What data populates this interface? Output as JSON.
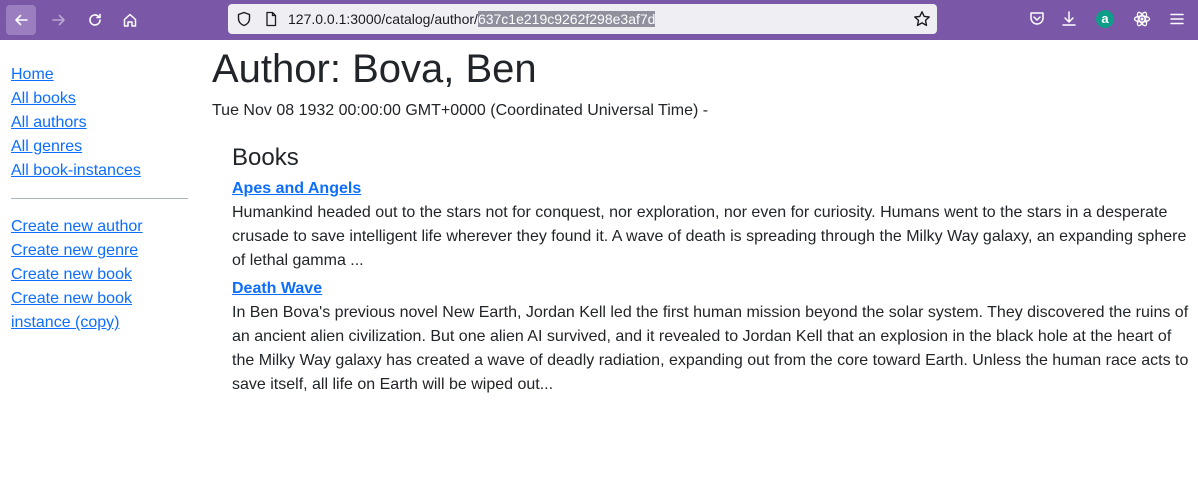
{
  "browser": {
    "url_prefix": "127.0.0.1:3000/catalog/author/",
    "url_selected": "637c1e219c9262f298e3af7d",
    "toolbar_color": "#7b57a8",
    "extension_a_label": "a"
  },
  "sidebar": {
    "nav": [
      {
        "label": "Home"
      },
      {
        "label": "All books"
      },
      {
        "label": "All authors"
      },
      {
        "label": "All genres"
      },
      {
        "label": "All book-instances"
      }
    ],
    "create": [
      {
        "label": "Create new author"
      },
      {
        "label": "Create new genre"
      },
      {
        "label": "Create new book"
      },
      {
        "label": "Create new book instance (copy)"
      }
    ]
  },
  "author": {
    "title": "Author: Bova, Ben",
    "dates": "Tue Nov 08 1932 00:00:00 GMT+0000 (Coordinated Universal Time) -"
  },
  "books": {
    "heading": "Books",
    "items": [
      {
        "title": "Apes and Angels",
        "summary": "Humankind headed out to the stars not for conquest, nor exploration, nor even for curiosity. Humans went to the stars in a desperate crusade to save intelligent life wherever they found it. A wave of death is spreading through the Milky Way galaxy, an expanding sphere of lethal gamma ..."
      },
      {
        "title": "Death Wave",
        "summary": "In Ben Bova's previous novel New Earth, Jordan Kell led the first human mission beyond the solar system. They discovered the ruins of an ancient alien civilization. But one alien AI survived, and it revealed to Jordan Kell that an explosion in the black hole at the heart of the Milky Way galaxy has created a wave of deadly radiation, expanding out from the core toward Earth. Unless the human race acts to save itself, all life on Earth will be wiped out..."
      }
    ]
  }
}
